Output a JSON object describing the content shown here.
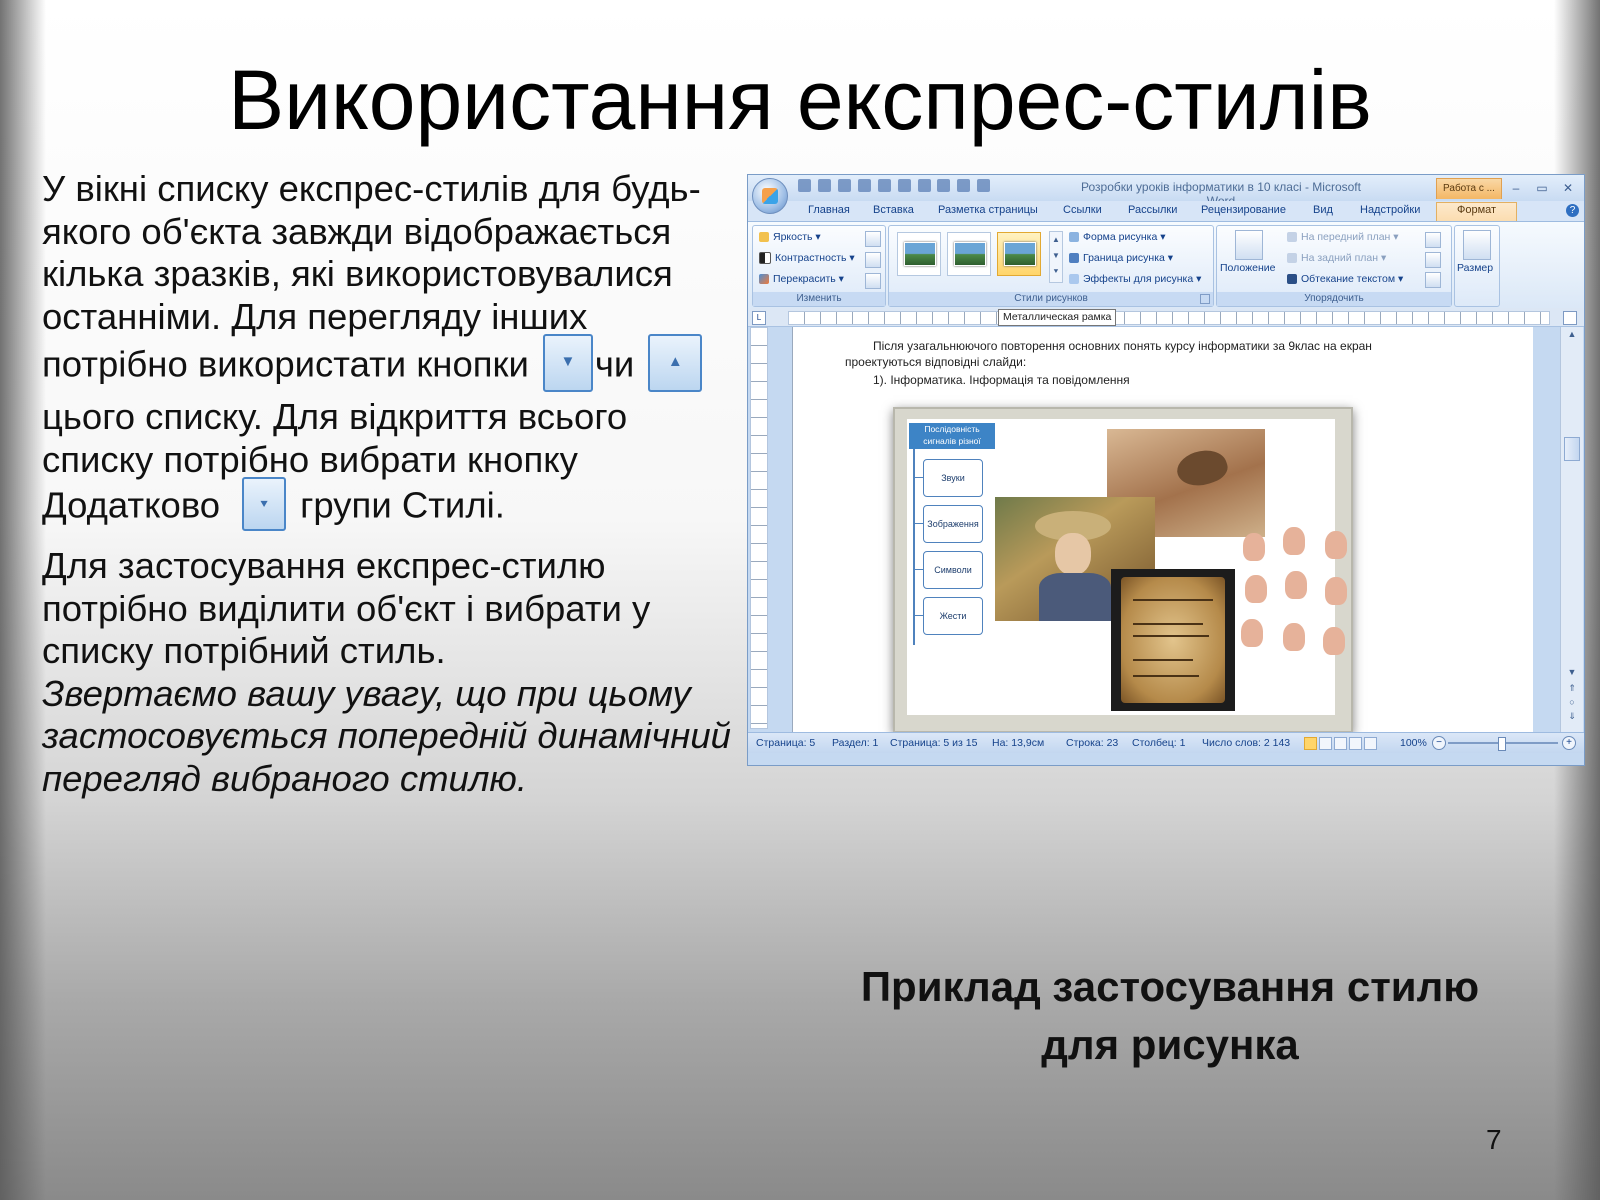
{
  "slide": {
    "title": "Використання експрес-стилів",
    "paragraph1": {
      "part1": "У вікні списку експрес-стилів для будь-якого об'єкта завжди відображається кілька зразків, які використовувалися останніми. Для перегляду інших потрібно використати кнопки",
      "part2": "чи",
      "part3": "цього списку. Для відкриття всього списку потрібно вибрати кнопку Додатково",
      "part4": "групи Стилі."
    },
    "paragraph2": "Для застосування експрес-стилю потрібно виділити об'єкт і вибрати у списку потрібний стиль.",
    "paragraph2_italic": "Звертаємо вашу увагу, що при цьому застосовується попередній динамічний перегляд вибраного стилю.",
    "inline_buttons": [
      "scroll-down-icon",
      "scroll-up-icon",
      "more-icon"
    ],
    "caption_line1": "Приклад застосування стилю",
    "caption_line2": "для рисунка",
    "page_number": "7"
  },
  "word": {
    "window_title": "Розробки уроків інформатики в 10 класі - Microsoft Word",
    "context_tab": "Работа с ...",
    "tabs": [
      {
        "label": "Главная"
      },
      {
        "label": "Вставка"
      },
      {
        "label": "Разметка страницы"
      },
      {
        "label": "Ссылки"
      },
      {
        "label": "Рассылки"
      },
      {
        "label": "Рецензирование"
      },
      {
        "label": "Вид"
      },
      {
        "label": "Надстройки"
      },
      {
        "label": "Формат"
      }
    ],
    "active_tab": "Формат",
    "groups": {
      "adjust": {
        "label": "Изменить",
        "buttons": [
          "Яркость",
          "Контрастность",
          "Перекрасить"
        ]
      },
      "styles": {
        "label": "Стили рисунков",
        "buttons": [
          "Форма рисунка",
          "Граница рисунка",
          "Эффекты для рисунка"
        ]
      },
      "arrange": {
        "label": "Упорядочить",
        "position": "Положение",
        "buttons": [
          "На передний план",
          "На задний план",
          "Обтекание текстом"
        ]
      },
      "size": {
        "label": "Размер"
      }
    },
    "tooltip": "Металлическая рамка",
    "document": {
      "line1": "Після узагальнюючого повторення основних понять курсу інформатики за 9клас на екран",
      "line2": "проектуються відповідні слайди:",
      "line3": "1). Інформатика. Інформація та повідомлення"
    },
    "diagram": {
      "title": "Послідовність сигналів різної природи",
      "boxes": [
        "Звуки",
        "Зображення",
        "Символи",
        "Жести"
      ]
    },
    "status": {
      "page": "Страница: 5",
      "section": "Раздел: 1",
      "page_of": "Страница: 5 из 15",
      "at": "На: 13,9см",
      "line": "Строка: 23",
      "column": "Столбец: 1",
      "words": "Число слов: 2 143",
      "zoom": "100%"
    },
    "colors": {
      "ribbon_blue": "#c5d9f1",
      "context_orange": "#f4b765",
      "text_blue": "#15428b"
    }
  }
}
